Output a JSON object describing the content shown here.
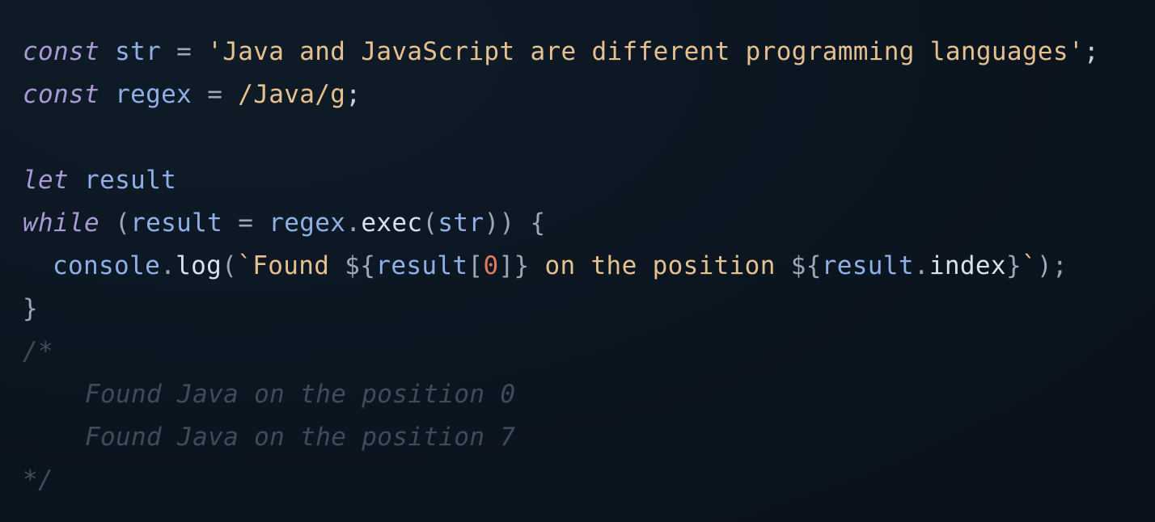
{
  "code": {
    "line1": {
      "kw": "const",
      "name": "str",
      "op": "=",
      "value": "'Java and JavaScript are different programming languages'",
      "end": ";"
    },
    "line2": {
      "kw": "const",
      "name": "regex",
      "op": "=",
      "value": "/Java/g",
      "end": ";"
    },
    "line3": {
      "kw": "let",
      "name": "result"
    },
    "line4": {
      "kw": "while",
      "open_paren": "(",
      "var": "result",
      "op": "=",
      "obj": "regex",
      "dot": ".",
      "method": "exec",
      "arg_open": "(",
      "arg": "str",
      "close": "))",
      "brace": "{"
    },
    "line5": {
      "obj": "console",
      "dot": ".",
      "method": "log",
      "open": "(",
      "tpl_start": "`Found ",
      "interp1_open": "${",
      "interp1_var": "result",
      "interp1_bracket_open": "[",
      "interp1_index": "0",
      "interp1_bracket_close": "]",
      "interp1_close": "}",
      "tpl_mid": " on the position ",
      "interp2_open": "${",
      "interp2_var": "result",
      "interp2_dot": ".",
      "interp2_prop": "index",
      "interp2_close": "}",
      "tpl_end": "`",
      "close": ");"
    },
    "line6": {
      "brace": "}"
    },
    "comment": {
      "open": "/*",
      "out1": "Found Java on the position 0",
      "out2": "Found Java on the position 7",
      "close": "*/"
    }
  },
  "colors": {
    "background": "#0c1620",
    "keyword": "#a99ad6",
    "identifier": "#8fb0e6",
    "string": "#e6c08f",
    "number": "#e07a5f",
    "comment": "#3e4c59"
  }
}
